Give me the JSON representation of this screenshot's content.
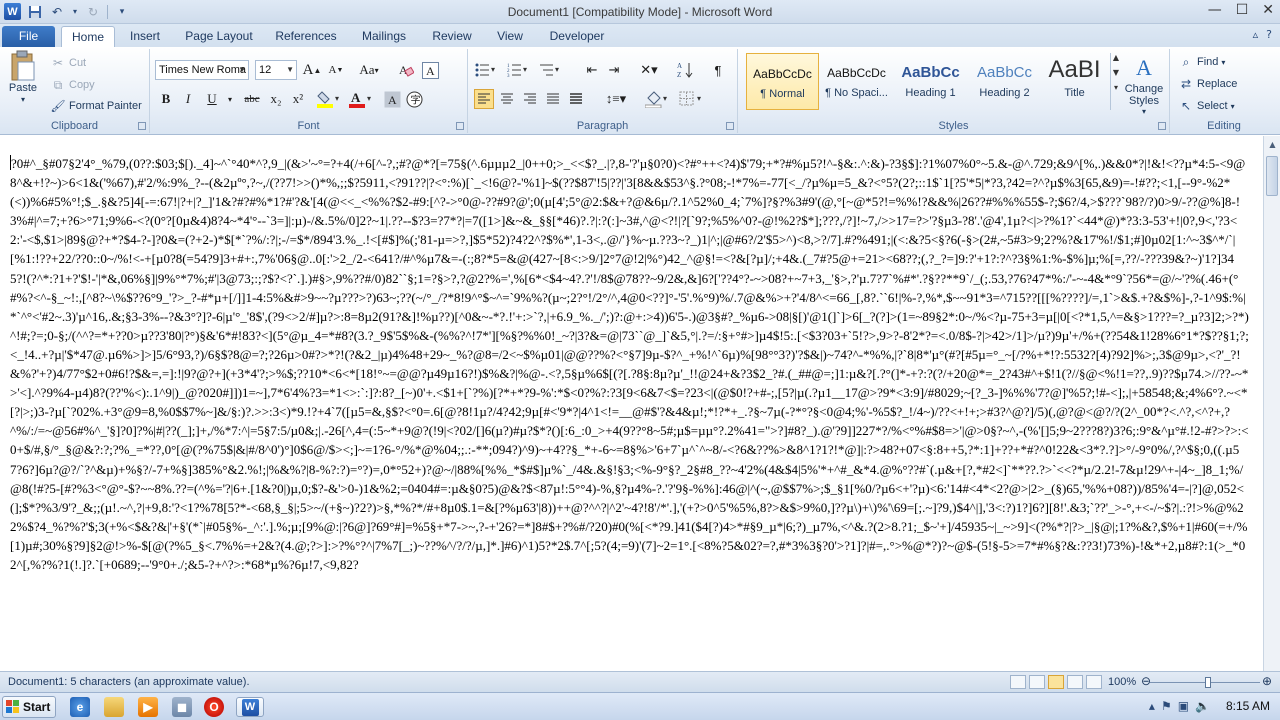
{
  "window": {
    "title": "Document1 [Compatibility Mode]  -  Microsoft Word",
    "app_logo_letter": "W",
    "controls": [
      "minimize-icon",
      "maximize-icon",
      "close-icon"
    ]
  },
  "quick_access": [
    "save-icon",
    "undo-icon",
    "redo-icon",
    "customize-icon"
  ],
  "ribbon_tabs": [
    {
      "label": "File"
    },
    {
      "label": "Home",
      "active": true
    },
    {
      "label": "Insert"
    },
    {
      "label": "Page Layout"
    },
    {
      "label": "References"
    },
    {
      "label": "Mailings"
    },
    {
      "label": "Review"
    },
    {
      "label": "View"
    },
    {
      "label": "Developer"
    }
  ],
  "clipboard": {
    "label": "Clipboard",
    "paste": "Paste",
    "cut": "Cut",
    "copy": "Copy",
    "format_painter": "Format Painter"
  },
  "font": {
    "label": "Font",
    "font_name": "Times New Roma",
    "font_size": "12",
    "grow": "A",
    "shrink": "A",
    "change_case": "Aa",
    "bold": "B",
    "italic": "I",
    "underline": "U",
    "strike": "abc",
    "subscript": "x₂",
    "superscript": "x²",
    "font_color": "A",
    "font_color_hex": "#e01b1b",
    "highlight_hex": "#ffff00"
  },
  "paragraph": {
    "label": "Paragraph",
    "show_marks": "¶"
  },
  "styles": {
    "label": "Styles",
    "tiles": [
      {
        "sample": "AaBbCcDc",
        "name": "¶ Normal",
        "selected": true
      },
      {
        "sample": "AaBbCcDc",
        "name": "¶ No Spaci..."
      },
      {
        "sample": "AaBbCc",
        "name": "Heading 1"
      },
      {
        "sample": "AaBbCc",
        "name": "Heading 2"
      },
      {
        "sample": "AaBI",
        "name": "Title"
      }
    ],
    "change_styles": "Change Styles"
  },
  "editing": {
    "label": "Editing",
    "find": "Find",
    "replace": "Replace",
    "select": "Select"
  },
  "document": {
    "text": "?0#^_§#07§2'4°_%79,(0??:$03;$[)._4]~^`°40*^?,9_|(&>'~°=?+4(/+6[^-?,;#?@*?[=75§(^.6µµµ2_|0++0;>_<<$?_.|?,8-'?'µ§0?0)<?#°++<?4)$'79;+*?#%µ5?!^-§&:.^:&)-?3§$]:?1%07%0°~5.&-@^.729;&9^[%,.)&&0*?|!&!<??µ*4:5-<9@8^&+!?~)>6<1&('%67),#'2/%:9%_?--(&2µº°,?~,/(??7!>>()*%,;;$?5911,<?91??|?<°:%)[`_<!6@?-'%1]~$(??$87'!5|??|'3[8&&$53^§.?°08;-!*7%=-77[<_/?µ%µ=5_&?<°5?(2?;::1$`1[?5'*5|*?3,?42=?^?µ$%3[65,&9)=-!#??;<1,[--9°-%2*(<))%6#5%°!;$_.§&?5]4[-=:67!|?+|?_]'1&?#?#%*1?#'?&'[4(@<<_<%%?$2-#9:[^?->°0@-??#9?@';0(µ[4';5°@2:$&+?@&6µ/?.1^52%0_4;`7%]?§?%3#9'(@,°[~@*5?!=%%!?&&%|26??#%%%55$-?;$6?/4,>$???`98?/?)0>9/-??@%]8-!3%#|^=7;+?6>°71;9%6-<?(0°?[0µ&4)8?4~*4'°--`3=]|:µ)-/&.5%/0]2?~1|.??--$?3=?7*?|=7([1>]&~&_§§[*46)?.?|:?(:]~3#,^@<?!|?[`9?;%5%^0?-@!%2?$*];???,/?]!~7,/>>17=?>'?§µ3-?8'.'@4',1µ?<|>?%1?`<44*@)*?3:3-53'+!|0?,9<,'?3<2:'-<$,$1>|89§@?+*?$4-?-]?0&=(?+2-)*$[*`?%/:?|;-/=$*/894'3.%_.!<[#$]%(;'81-µ=>?,]$5*52)?4?2^?$%*',1-3<,.@/'}%~µ.??3~?_)1|^;|@#6?/2'$5>^)<8,>?/7].#?%491;|(<:&?5<§?6(-§>(2#,~5#3>9;2?%?&17'%!/$1;#]0µ02[1:^~3$^*/`|[%1:!??+22/??0::0~/%!<-+[µ0?8(=54?9]3+#+:,7%'06§@..0[:'>2_/2-<641?/#^%µ7&=-(:;8?*5=&@(427~[8<:>9/]2°7@!2|%°)42_^@§!=<?&[?µ]/;+4&.(_7#?5@+=21><68??;(,?_?=]9:?'+1?:?^?3§%1:%-$%]µ;%[=,??/-???39&?~)'1?]345?!(?^*:?1+?'$!-'|*&,06%§]|9%°*7%;#'|3@73;:;?$?<?`.].)#§>,9%??#/0)82``§;1=?§>?,?@2?%=',%[6*<$4~4?.?'!/8$@78??~9/2&,&]6?['??4°?-~>08?+~7+3,_'§>,?'µ.7?7`%#*'.?§??**9`/_(;.53,?76?47*%:/'-~-4&*°9`?56*=@/~'?%(.46+(°#%?<^-§_~!:,[^8?~\\%$??6°9_'?>_?-#*µ+[/]]1-4:5%&#>9~~?µ???>?)63~;??(~/°_/?*8!9^°$~^=`9%%?(µ~;2?°!/2°/^,4@0<??]°-'5'.%°9)%/.7@&%>+?'4/8^<=66_[,8?.``6!|%-?,%*,$~~91*3=^715??[[[%????]/=,1`>&$.+?&$%]-,?-1^9$:%|*`^°<'#2~.3)'µ^16,.&;§3-3%--?&3°?]?-6|µ'°_'8$',(?9<>2/#]µ?>:8=8µ2(91?&]!%µ??)[^0&~-*?.!'+:>`?,|+6.9_%._/';)?:@+:>4))6'5-.)@3§#?_%µ6->08|§[)'@1(]`]>6[_?(?]>(1=~89§2*:0~/%<?µ-75+3=µ[|0[<?*1,5,^=&§>1???=?_µ?3]2;>?*)^!#;?=;0-§;/(^^?=*+??0>µ??3'80|?°)§&'6*#!83?<](5°@µ_4=*#8?(3.?_9$'5$%&-(%%?^!7*'][%§?%%0!_~?|3?&=@|73``@_]`&5,°|.?=/:§+°#>]µ4$!5:.[<$3?03+`5!?>,9>?-8'2*?=<.0/8$-?|>42>/1]>/µ?)9µ'+/%+(??54&1!28%6°1*?$??§1;?;<_!4..+?µ|'$*47@.µ6%>]>]5/6°93,?)/6§$?8@=?;?26µ>0#?>*?!(?&2_|µ)4%48+29~_%?@8=/2<~$%µ01|@@??%?<°§7]9µ-$?^_+%!^`6µ)%[98°°3?)'?$&|)~74?^-*%%,|?`8|8*'µ°(#?[#5µ=°_~[/?%+*!?:5532?[4)?92]%>;,3$@9µ>,<?'_?!&%?'+?)4/77°$2+0#6!?$&=,=]:!|9?@?+](+3*4'?;>%$;??10*<6<*[18!°~=@@?µ49µ16?!)$%&?|%@-.<?,5§µ%6$[(?[.?8§:8µ?µ'_!!@24+&?3$2_?#.(_##@=;]1:µ&?[.?°(]*-+?:?(?/+20@*=_2?43#^+$!1(?//§@<%!1=??,.9)??$µ74.>//??-~*>'<].^?9%4-µ4)8?(??'%<):.1^9|)_@?020#]])1=~],7*6'4%?3=*1<>:`:]?:8?_[~)0'+.<$1+[`?%)[?*+*?9-%':*$<0?%?:?3[9<6&7<$=?23<|(@$0!?+#-;,[5?|µ(.?µ1__17@>?9*<3:9]/#8029;~[?_3-]%%%'7?@]'%5?;!#-<];,|+58548;&;4%6°?.~<*[?|>;)3-?µ[`?02%.+3°@9=8,%0$$7%~]&/§:)?.>>:3<)*9.!?+4`7([µ5=&,§$?<°0=.6[@?8!1µ?/4?42;9µ[#<'9*?|4^1<!=__@#$'?&4&µ!;*!?*+_.?§~7µ(-?*°?§<0@4;%'-%5$?_!/4~)/??<+!+;>#3?^@?]/5)(,@?@<@?/?(2^_00*?<.^?,<^?+,?^%/:/=~@56#%^_'§]?0]?%|#|??(_];]+,/%*7:^|=5§7:5/µ0&;|.-26[^,4=(:5~*+9@?(!9|<?02/[]6(µ?)#µ?$*?()[:6_:0_>+4(9??°8~5#;µ$=µµ°?.2%41=\">?]#8?_).@'?9]]227*?/%<°%#$8=>'|@>0§?~^,-(%'[]5;9~2???8?)3?6;:9°&^µ°#.!2-#?>?>:<0+$/#,§/°_§@&?:?;?%_=*??,0°[@(?%75$|&|#/8^0')°]0$6@/$><;]~=1?6-°/%*@%04;;.:-**;094?)^9)~+4??§_*+-6~=8§%>'6+7`µ^`^~8/-<?6&??%>&8^1?1?!*@]|:?>48?+07<§:8++5,?*:1]+??+*#?^0!22&<3*?.?]>°/-9°0%/,?^$§;0,((.µ57?6?]6µ?@?/`?^&µ)+%§?/-7+%§]385%°&2.%!;|%&%?|8-%?:?)=°?)=,0*°52+)?@~/|88%[%%_*$#$]µ%`_/4&.&§!§3;<%-9°§?_2§#8_??~4'2%(4&$4|5%'*+^#_&*4.@%°??#`(.µ&+[?,*#2<]`**??.?>`<<?*µ/2.2!-7&µ!29^+-|4~_]8_1;%/@8(!#?5-[#?%3<°@°-$?~~8%.??=(^%='?|6+.[1&?0|)µ,0;$?-&'>0-)1&%2;=0404#=:µ&§0?5)@&?$<87µ!:5°°4)-%,§?µ4%-?.'?'9§-%%]:46@|^(~,@$$7%>;$_§1[%0/?µ6<+'?µ)<6:'14#<4*<2?@>|2>_(§)65,'%%+08?))/85%'4=-|?]@,052<(];$*?%3/9'?_&;;(µ!.~^,?|+9,8:'?<1?%78[5?*-<68,§_§|;5>~/(+§~)?2?)>§,*%?*/#+8µ0$.1=&[?%µ63'|8))++@?^^?|^2'~4?!8'/*'.],'(+?>0^5'%5%,8?>&$>9%0,]??µ\\)+\\)%'\\69=[;.~]?9,)$4^|],'3<:?)1?]6?][8!'.&3;`??'_>-°,+<-/~$?|.:?!>%@%22%$?4_%?%?'$;3(+%<$&?&|'+§'(*`|#05§%-_^:'.].%;µ;[9%@:|?6@]?69°#]=%5§+*7->~,?-+'26?=*]8#$+?%#/?20)#0(%[<*?9.]41($4[?)4>*#§9_µ*|6;?)_µ7%,<^&.?(2>8.?1;_$~'+]/45935~|_~>9]<(?%*?|?>_|§@|;1?%&?,$%+1|#60(=+/%[1)µ#;30%§?9]§2@!>%-$[@(?%5_§<.7%%=+2&?(4.@;?>]:>?%°?^|7%7[_;)~??%^/?/?/µ,]*.]#6)^1)5?*2$.7^[;5?(4;=9)'(7]~2=1°.[<8%?5&02?=?,#*3%3§?0'>?1]?|#=,.°>%@*?)?~@$-(5!§-5>=7*#%§?&:??3!)73%)-!&*+2,µ8#?:1(>_*02^[,%?%?1(!.]?.`[+0689;--'9°0+./;&5-?+^?>:*68*µ%?6µ!7,<9,82?"
  },
  "status_bar": {
    "text": "Document1: 5 characters (an approximate value).",
    "zoom": "100%"
  },
  "taskbar": {
    "start": "Start",
    "clock": "8:15 AM"
  }
}
